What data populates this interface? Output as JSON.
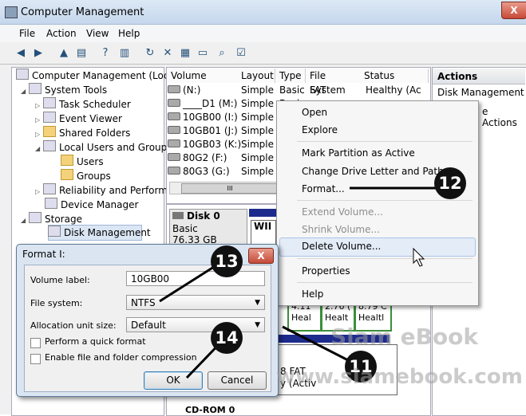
{
  "window": {
    "title": "Computer Management",
    "close": "X"
  },
  "menu": [
    "File",
    "Action",
    "View",
    "Help"
  ],
  "tree": {
    "root": "Computer Management (Local",
    "system_tools": "System Tools",
    "task_scheduler": "Task Scheduler",
    "event_viewer": "Event Viewer",
    "shared_folders": "Shared Folders",
    "local_users": "Local Users and Groups",
    "users": "Users",
    "groups": "Groups",
    "reliability": "Reliability and Performa",
    "device_manager": "Device Manager",
    "storage": "Storage",
    "disk_management": "Disk Management"
  },
  "volumes": {
    "columns": [
      "Volume",
      "Layout",
      "Type",
      "File System",
      "Status"
    ],
    "rows": [
      {
        "volume": "(N:)",
        "layout": "Simple",
        "type": "Basic",
        "fs": "FAT",
        "status": "Healthy (Ac"
      },
      {
        "volume": "____D1 (M:)",
        "layout": "Simple",
        "type": "Basic",
        "fs": "",
        "status": ""
      },
      {
        "volume": "10GB00 (I:)",
        "layout": "Simple",
        "type": "",
        "fs": "",
        "status": ""
      },
      {
        "volume": "10GB01 (J:)",
        "layout": "Simple",
        "type": "",
        "fs": "",
        "status": ""
      },
      {
        "volume": "10GB03 (K:)",
        "layout": "Simple",
        "type": "",
        "fs": "",
        "status": ""
      },
      {
        "volume": "80G2 (F:)",
        "layout": "Simple",
        "type": "",
        "fs": "",
        "status": ""
      },
      {
        "volume": "80G3 (G:)",
        "layout": "Simple",
        "type": "",
        "fs": "",
        "status": ""
      }
    ],
    "scroll_grip": "III"
  },
  "graph": {
    "disk0_name": "Disk 0",
    "disk0_type": "Basic",
    "disk0_size": "76.33 GB",
    "part_w": "WII",
    "part_a1": "4.11",
    "part_a2": "Heal",
    "part_b1": "2.76 (",
    "part_b2": "Healt",
    "part_c1": "8.79 C",
    "part_c2": "Healtl",
    "p2_line1": "8 FAT",
    "p2_line2": "y (Activ",
    "cdrom": "CD-ROM 0"
  },
  "actions": {
    "header": "Actions",
    "item": "Disk Management",
    "more": "e Actions"
  },
  "context_menu": {
    "open": "Open",
    "explore": "Explore",
    "mark_active": "Mark Partition as Active",
    "change_letter": "Change Drive Letter and Paths...",
    "format": "Format...",
    "extend": "Extend Volume...",
    "shrink": "Shrink Volume...",
    "delete": "Delete Volume...",
    "properties": "Properties",
    "help": "Help"
  },
  "format_dialog": {
    "title": "Format I:",
    "close": "X",
    "volume_label_label": "Volume label:",
    "volume_label_value": "10GB00",
    "file_system_label": "File system:",
    "file_system_value": "NTFS",
    "alloc_label": "Allocation unit size:",
    "alloc_value": "Default",
    "quick_format": "Perform a quick format",
    "compression": "Enable file and folder compression",
    "ok": "OK",
    "cancel": "Cancel"
  },
  "callouts": [
    "11",
    "12",
    "13",
    "14"
  ],
  "watermark": {
    "line1": "Siam eBook",
    "line2": "www.siamebook.com"
  }
}
